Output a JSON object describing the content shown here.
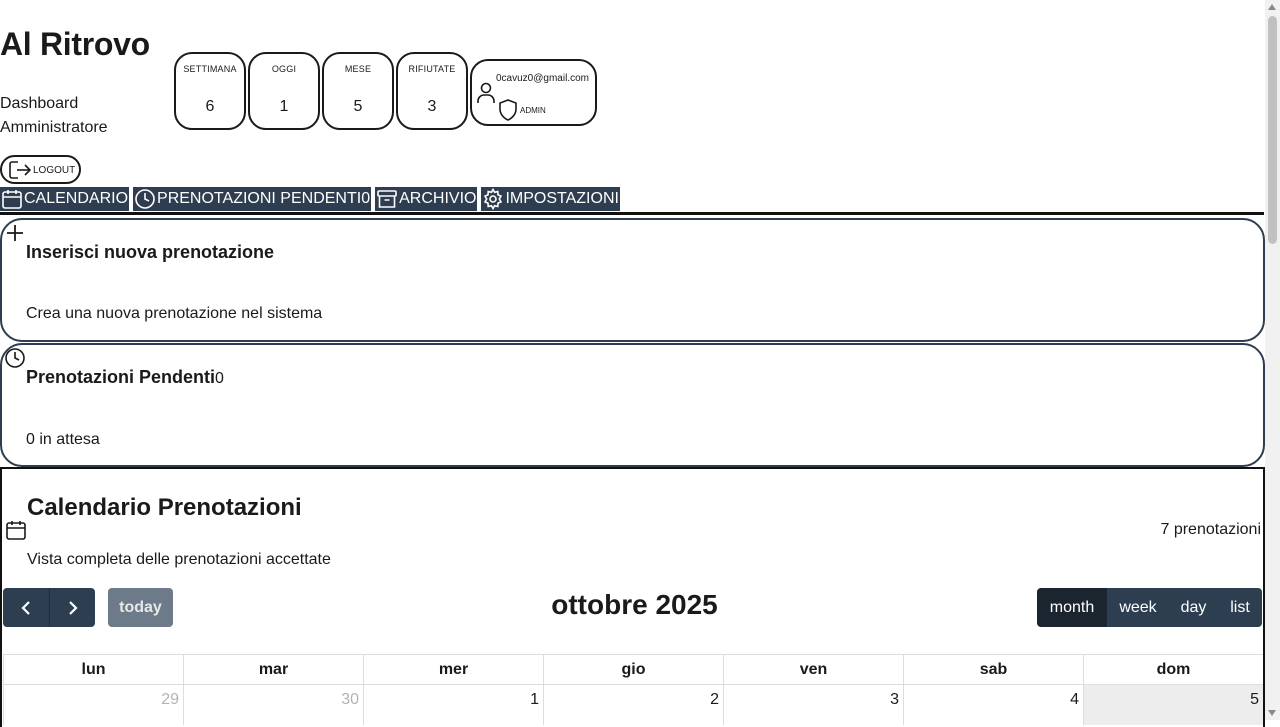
{
  "app": {
    "title": "Al Ritrovo",
    "subtitle": "Dashboard Amministratore"
  },
  "stats": [
    {
      "label": "SETTIMANA",
      "value": "6"
    },
    {
      "label": "OGGI",
      "value": "1"
    },
    {
      "label": "MESE",
      "value": "5"
    },
    {
      "label": "RIFIUTATE",
      "value": "3"
    }
  ],
  "user": {
    "email": "0cavuz0@gmail.com",
    "role": "ADMIN",
    "icon": "user-icon",
    "role_icon": "shield-icon"
  },
  "logout": {
    "label": "LOGOUT",
    "icon": "logout-icon"
  },
  "nav": {
    "tabs": [
      {
        "label": "CALENDARIO",
        "icon": "calendar-icon"
      },
      {
        "label": "PRENOTAZIONI PENDENTI",
        "count": "0",
        "icon": "clock-icon"
      },
      {
        "label": "ARCHIVIO",
        "icon": "archive-icon"
      },
      {
        "label": "IMPOSTAZIONI",
        "icon": "gear-icon"
      }
    ],
    "tab_color": "#2e3d4f"
  },
  "cards": {
    "new_booking": {
      "title": "Inserisci nuova prenotazione",
      "description": "Crea una nuova prenotazione nel sistema",
      "icon": "plus-icon"
    },
    "pending": {
      "title": "Prenotazioni Pendenti",
      "count": "0",
      "description": "0 in attesa",
      "icon": "clock-icon"
    }
  },
  "calendar": {
    "title": "Calendario Prenotazioni",
    "subtitle": "Vista completa delle prenotazioni accettate",
    "count_label": "7 prenotazioni",
    "icon": "calendar-icon",
    "prev_icon": "chevron-left-icon",
    "next_icon": "chevron-right-icon",
    "today_label": "today",
    "month_title": "ottobre 2025",
    "views": [
      {
        "label": "month",
        "active": true
      },
      {
        "label": "week",
        "active": false
      },
      {
        "label": "day",
        "active": false
      },
      {
        "label": "list",
        "active": false
      }
    ],
    "weekdays": [
      "lun",
      "mar",
      "mer",
      "gio",
      "ven",
      "sab",
      "dom"
    ],
    "first_row": [
      {
        "day": "29",
        "other": true
      },
      {
        "day": "30",
        "other": true
      },
      {
        "day": "1",
        "other": false
      },
      {
        "day": "2",
        "other": false
      },
      {
        "day": "3",
        "other": false
      },
      {
        "day": "4",
        "other": false
      },
      {
        "day": "5",
        "other": false,
        "today": true
      }
    ],
    "button_color": "#2c3e50"
  }
}
